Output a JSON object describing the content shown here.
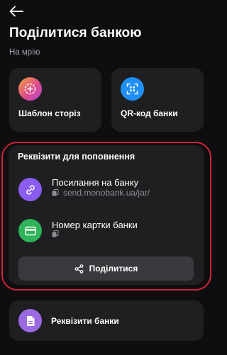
{
  "header": {
    "title": "Поділитися банкою",
    "subtitle": "На мрію"
  },
  "actions": {
    "template_label": "Шаблон сторіз",
    "qr_label": "QR-код банки"
  },
  "details": {
    "heading": "Реквізити для поповнення",
    "link_title": "Посилання на банку",
    "link_value": "send.monobank.ua/jar/",
    "card_title": "Номер картки банки",
    "card_value": "",
    "share_label": "Поділитися"
  },
  "requisites": {
    "label": "Реквізити банки"
  },
  "colors": {
    "background": "#0e0e10",
    "card": "#1f1f22",
    "highlight_border": "#d0213a",
    "link_icon": "#8a5cf0",
    "card_icon": "#2fb45a",
    "qr_icon": "#1f8ff5",
    "requisites_icon": "#9b6ae0"
  },
  "icons": {
    "back": "arrow-left-icon",
    "template": "plus-circle-icon",
    "qr": "qr-code-icon",
    "link": "link-icon",
    "card": "credit-card-icon",
    "copy": "copy-icon",
    "share": "share-icon",
    "document": "document-icon"
  }
}
